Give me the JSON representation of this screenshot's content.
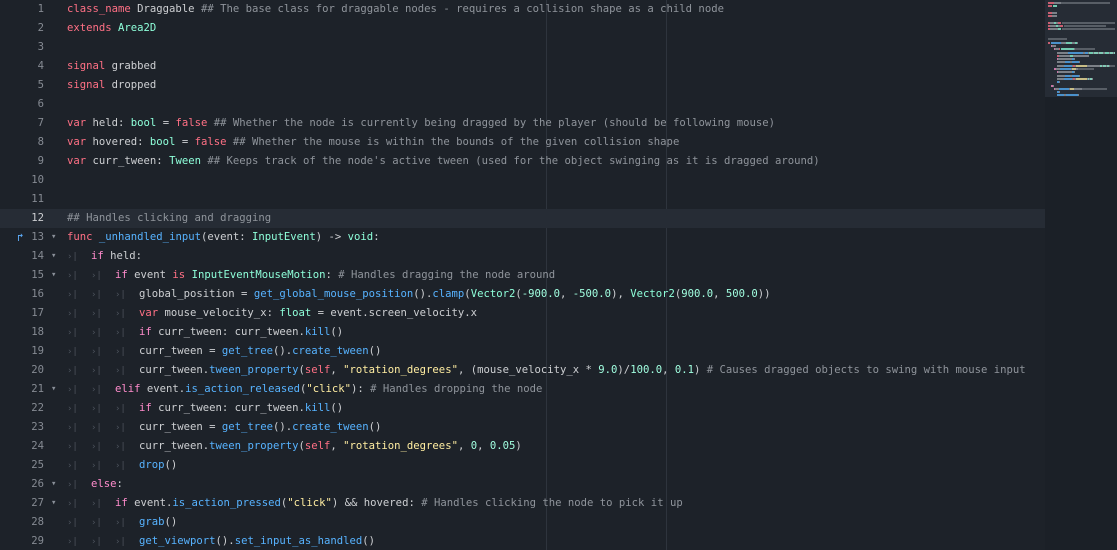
{
  "editor": {
    "current_line": 12,
    "call_icon_line": 13,
    "lines": [
      {
        "n": "1",
        "fold": "",
        "tabs": 0,
        "tokens": [
          [
            "kw",
            "class_name"
          ],
          [
            "id",
            " Draggable "
          ],
          [
            "cm",
            "## The base class for draggable nodes - requires a collision shape as a child node"
          ]
        ]
      },
      {
        "n": "2",
        "fold": "",
        "tabs": 0,
        "tokens": [
          [
            "kw",
            "extends"
          ],
          [
            "id",
            " "
          ],
          [
            "ty",
            "Area2D"
          ]
        ]
      },
      {
        "n": "3",
        "fold": "",
        "tabs": 0,
        "tokens": []
      },
      {
        "n": "4",
        "fold": "",
        "tabs": 0,
        "tokens": [
          [
            "kw",
            "signal"
          ],
          [
            "id",
            " grabbed"
          ]
        ]
      },
      {
        "n": "5",
        "fold": "",
        "tabs": 0,
        "tokens": [
          [
            "kw",
            "signal"
          ],
          [
            "id",
            " dropped"
          ]
        ]
      },
      {
        "n": "6",
        "fold": "",
        "tabs": 0,
        "tokens": []
      },
      {
        "n": "7",
        "fold": "",
        "tabs": 0,
        "tokens": [
          [
            "kw",
            "var"
          ],
          [
            "id",
            " held: "
          ],
          [
            "ty",
            "bool"
          ],
          [
            "id",
            " = "
          ],
          [
            "kw",
            "false"
          ],
          [
            "id",
            " "
          ],
          [
            "cm",
            "## Whether the node is currently being dragged by the player (should be following mouse)"
          ]
        ]
      },
      {
        "n": "8",
        "fold": "",
        "tabs": 0,
        "tokens": [
          [
            "kw",
            "var"
          ],
          [
            "id",
            " hovered: "
          ],
          [
            "ty",
            "bool"
          ],
          [
            "id",
            " = "
          ],
          [
            "kw",
            "false"
          ],
          [
            "id",
            " "
          ],
          [
            "cm",
            "## Whether the mouse is within the bounds of the given collision shape"
          ]
        ]
      },
      {
        "n": "9",
        "fold": "",
        "tabs": 0,
        "tokens": [
          [
            "kw",
            "var"
          ],
          [
            "id",
            " curr_tween: "
          ],
          [
            "ty",
            "Tween"
          ],
          [
            "id",
            " "
          ],
          [
            "cm",
            "## Keeps track of the node's active tween (used for the object swinging as it is dragged around)"
          ]
        ]
      },
      {
        "n": "10",
        "fold": "",
        "tabs": 0,
        "tokens": []
      },
      {
        "n": "11",
        "fold": "",
        "tabs": 0,
        "tokens": []
      },
      {
        "n": "12",
        "fold": "",
        "tabs": 0,
        "tokens": [
          [
            "cm",
            "## Handles clicking and dragging"
          ]
        ]
      },
      {
        "n": "13",
        "fold": "⌄",
        "tabs": 0,
        "tokens": [
          [
            "kw",
            "func"
          ],
          [
            "id",
            " "
          ],
          [
            "fn",
            "_unhandled_input"
          ],
          [
            "id",
            "(event: "
          ],
          [
            "ty",
            "InputEvent"
          ],
          [
            "id",
            ") -> "
          ],
          [
            "ty",
            "void"
          ],
          [
            "id",
            ":"
          ]
        ]
      },
      {
        "n": "14",
        "fold": "⌄",
        "tabs": 1,
        "tokens": [
          [
            "cf",
            "if"
          ],
          [
            "id",
            " held:"
          ]
        ]
      },
      {
        "n": "15",
        "fold": "⌄",
        "tabs": 2,
        "tokens": [
          [
            "cf",
            "if"
          ],
          [
            "id",
            " event "
          ],
          [
            "kw",
            "is"
          ],
          [
            "id",
            " "
          ],
          [
            "ty",
            "InputEventMouseMotion"
          ],
          [
            "id",
            ": "
          ],
          [
            "cm",
            "# Handles dragging the node around"
          ]
        ]
      },
      {
        "n": "16",
        "fold": "",
        "tabs": 3,
        "tokens": [
          [
            "id",
            "global_position = "
          ],
          [
            "fn",
            "get_global_mouse_position"
          ],
          [
            "id",
            "()."
          ],
          [
            "fn",
            "clamp"
          ],
          [
            "id",
            "("
          ],
          [
            "ty",
            "Vector2"
          ],
          [
            "id",
            "("
          ],
          [
            "num",
            "-900.0"
          ],
          [
            "id",
            ", "
          ],
          [
            "num",
            "-500.0"
          ],
          [
            "id",
            "), "
          ],
          [
            "ty",
            "Vector2"
          ],
          [
            "id",
            "("
          ],
          [
            "num",
            "900.0"
          ],
          [
            "id",
            ", "
          ],
          [
            "num",
            "500.0"
          ],
          [
            "id",
            "))"
          ]
        ]
      },
      {
        "n": "17",
        "fold": "",
        "tabs": 3,
        "tokens": [
          [
            "kw",
            "var"
          ],
          [
            "id",
            " mouse_velocity_x: "
          ],
          [
            "ty",
            "float"
          ],
          [
            "id",
            " = event.screen_velocity.x"
          ]
        ]
      },
      {
        "n": "18",
        "fold": "",
        "tabs": 3,
        "tokens": [
          [
            "cf",
            "if"
          ],
          [
            "id",
            " curr_tween: curr_tween."
          ],
          [
            "fn",
            "kill"
          ],
          [
            "id",
            "()"
          ]
        ]
      },
      {
        "n": "19",
        "fold": "",
        "tabs": 3,
        "tokens": [
          [
            "id",
            "curr_tween = "
          ],
          [
            "fn",
            "get_tree"
          ],
          [
            "id",
            "()."
          ],
          [
            "fn",
            "create_tween"
          ],
          [
            "id",
            "()"
          ]
        ]
      },
      {
        "n": "20",
        "fold": "",
        "tabs": 3,
        "tokens": [
          [
            "id",
            "curr_tween."
          ],
          [
            "fn",
            "tween_property"
          ],
          [
            "id",
            "("
          ],
          [
            "kw",
            "self"
          ],
          [
            "id",
            ", "
          ],
          [
            "str",
            "\"rotation_degrees\""
          ],
          [
            "id",
            ", (mouse_velocity_x * "
          ],
          [
            "num",
            "9.0"
          ],
          [
            "id",
            ")/"
          ],
          [
            "num",
            "100.0"
          ],
          [
            "id",
            ", "
          ],
          [
            "num",
            "0.1"
          ],
          [
            "id",
            ") "
          ],
          [
            "cm",
            "# Causes dragged objects to swing with mouse input"
          ]
        ]
      },
      {
        "n": "21",
        "fold": "⌄",
        "tabs": 2,
        "tokens": [
          [
            "cf",
            "elif"
          ],
          [
            "id",
            " event."
          ],
          [
            "fn",
            "is_action_released"
          ],
          [
            "id",
            "("
          ],
          [
            "str",
            "\"click\""
          ],
          [
            "id",
            "): "
          ],
          [
            "cm",
            "# Handles dropping the node"
          ]
        ]
      },
      {
        "n": "22",
        "fold": "",
        "tabs": 3,
        "tokens": [
          [
            "cf",
            "if"
          ],
          [
            "id",
            " curr_tween: curr_tween."
          ],
          [
            "fn",
            "kill"
          ],
          [
            "id",
            "()"
          ]
        ]
      },
      {
        "n": "23",
        "fold": "",
        "tabs": 3,
        "tokens": [
          [
            "id",
            "curr_tween = "
          ],
          [
            "fn",
            "get_tree"
          ],
          [
            "id",
            "()."
          ],
          [
            "fn",
            "create_tween"
          ],
          [
            "id",
            "()"
          ]
        ]
      },
      {
        "n": "24",
        "fold": "",
        "tabs": 3,
        "tokens": [
          [
            "id",
            "curr_tween."
          ],
          [
            "fn",
            "tween_property"
          ],
          [
            "id",
            "("
          ],
          [
            "kw",
            "self"
          ],
          [
            "id",
            ", "
          ],
          [
            "str",
            "\"rotation_degrees\""
          ],
          [
            "id",
            ", "
          ],
          [
            "num",
            "0"
          ],
          [
            "id",
            ", "
          ],
          [
            "num",
            "0.05"
          ],
          [
            "id",
            ")"
          ]
        ]
      },
      {
        "n": "25",
        "fold": "",
        "tabs": 3,
        "tokens": [
          [
            "fn",
            "drop"
          ],
          [
            "id",
            "()"
          ]
        ]
      },
      {
        "n": "26",
        "fold": "⌄",
        "tabs": 1,
        "tokens": [
          [
            "cf",
            "else"
          ],
          [
            "id",
            ":"
          ]
        ]
      },
      {
        "n": "27",
        "fold": "⌄",
        "tabs": 2,
        "tokens": [
          [
            "cf",
            "if"
          ],
          [
            "id",
            " event."
          ],
          [
            "fn",
            "is_action_pressed"
          ],
          [
            "id",
            "("
          ],
          [
            "str",
            "\"click\""
          ],
          [
            "id",
            ") && hovered: "
          ],
          [
            "cm",
            "# Handles clicking the node to pick it up"
          ]
        ]
      },
      {
        "n": "28",
        "fold": "",
        "tabs": 3,
        "tokens": [
          [
            "fn",
            "grab"
          ],
          [
            "id",
            "()"
          ]
        ]
      },
      {
        "n": "29",
        "fold": "",
        "tabs": 3,
        "tokens": [
          [
            "fn",
            "get_viewport"
          ],
          [
            "id",
            "()."
          ],
          [
            "fn",
            "set_input_as_handled"
          ],
          [
            "id",
            "()"
          ]
        ]
      }
    ]
  },
  "colors": {
    "background": "#1d2229",
    "current_line": "#262c35",
    "keyword": "#ff7085",
    "control_flow": "#ff8ccc",
    "type": "#8effda",
    "function": "#57b3ff",
    "string": "#ffeda1",
    "number": "#a1ffe0",
    "comment": "#8f949b"
  },
  "icons": {
    "fold": "chevron-down-icon",
    "tab": "tab-indent-icon",
    "call": "function-override-icon"
  }
}
